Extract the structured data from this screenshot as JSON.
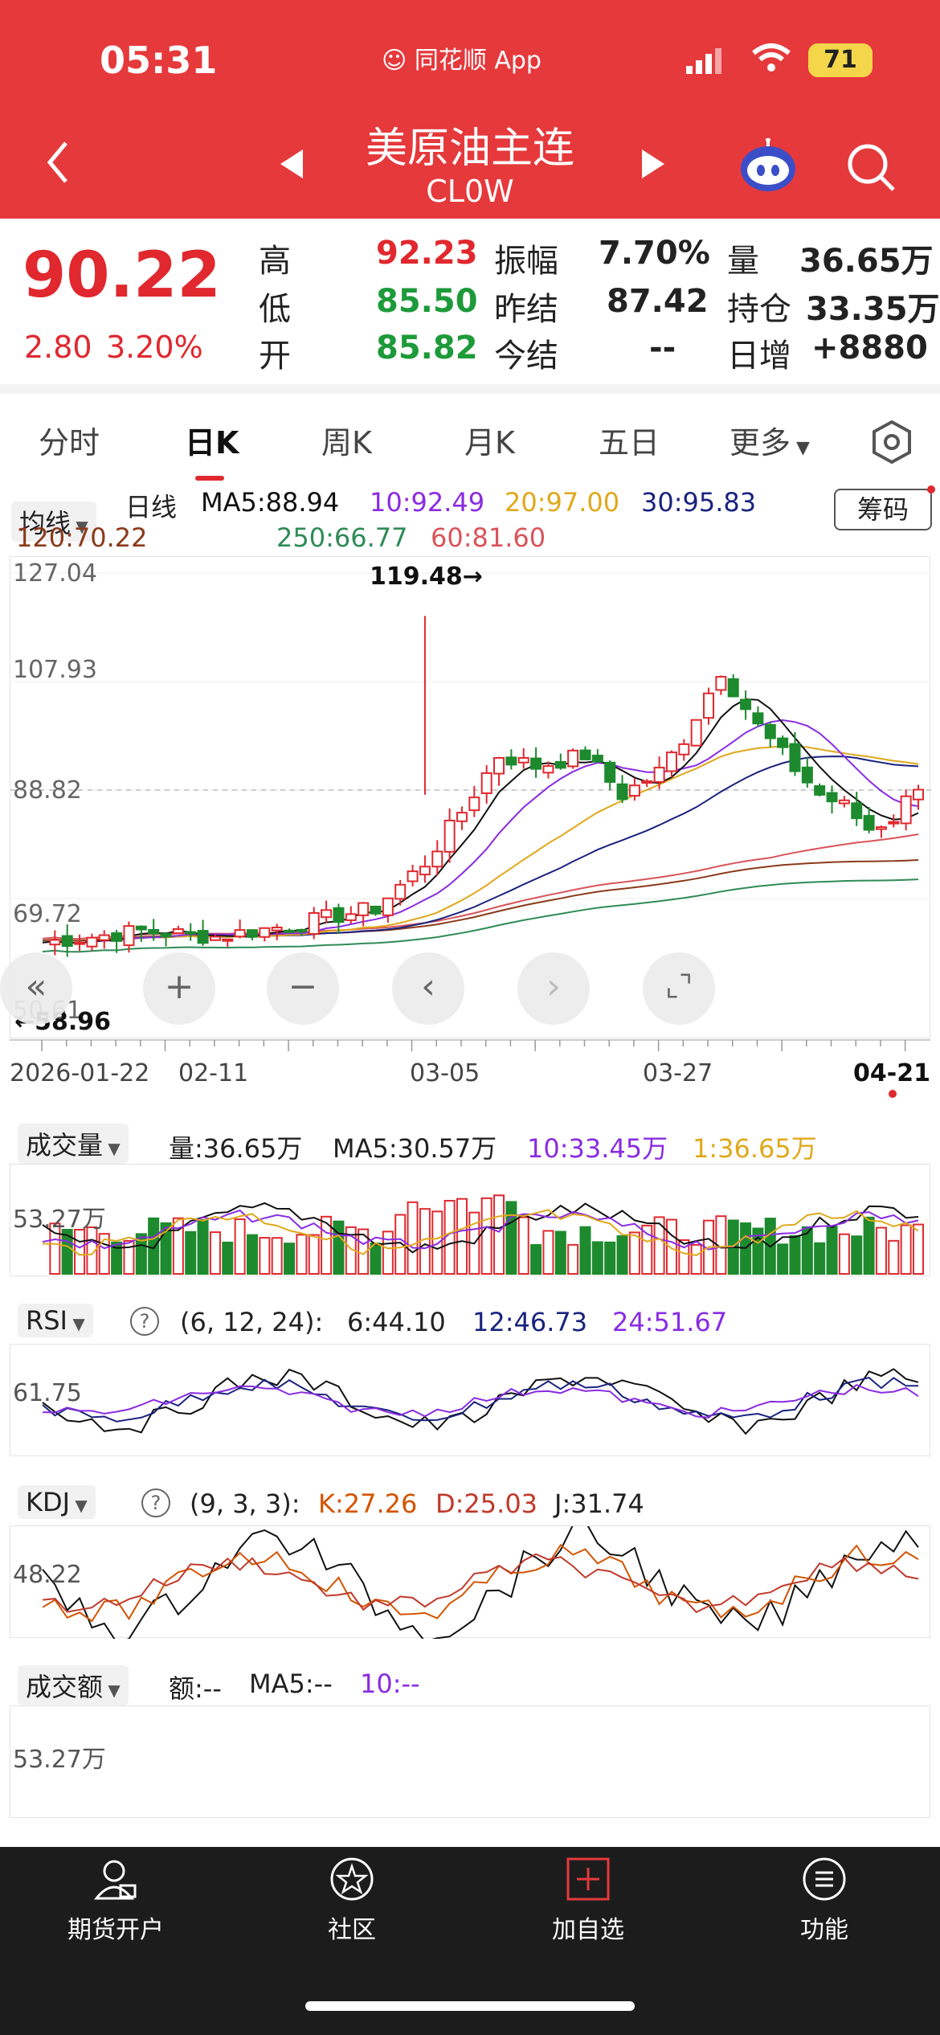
{
  "status": {
    "time": "05:31",
    "app": "同花顺 App",
    "battery": "71"
  },
  "header": {
    "title": "美原油主连",
    "code": "CL0W"
  },
  "quote": {
    "price": "90.22",
    "change": "2.80",
    "pct": "3.20%",
    "high_label": "高",
    "high": "92.23",
    "low_label": "低",
    "low": "85.50",
    "open_label": "开",
    "open": "85.82",
    "amp_label": "振幅",
    "amp": "7.70%",
    "prev_label": "昨结",
    "prev": "87.42",
    "today_label": "今结",
    "today": "--",
    "vol_label": "量",
    "vol": "36.65万",
    "oi_label": "持仓",
    "oi": "33.35万",
    "dinc_label": "日增",
    "dinc": "+8880"
  },
  "tabs": [
    "分时",
    "日K",
    "周K",
    "月K",
    "五日",
    "更多"
  ],
  "ma_bar": {
    "selector": "均线",
    "line": "日线",
    "ma5": "MA5:88.94",
    "ma10": "10:92.49",
    "ma20": "20:97.00",
    "ma30": "30:95.83",
    "ma120": "120:70.22",
    "ma250": "250:66.77",
    "ma60": "60:81.60",
    "chip_button": "筹码"
  },
  "colors": {
    "up": "#e0282e",
    "down": "#1d8a2e",
    "ma5": "#111111",
    "ma10": "#8a2be2",
    "ma20": "#e0a81c",
    "ma30": "#1a237e",
    "ma120": "#8b3a1a",
    "ma250": "#2e8b57",
    "ma60": "#d9545a",
    "header": "#e5393c"
  },
  "kline": {
    "axis_labels": [
      "127.04",
      "107.93",
      "88.82",
      "69.72",
      "50.61"
    ],
    "high_marker": "119.48→",
    "low_marker": "←58.96",
    "dates": [
      "2026-01-22",
      "02-11",
      "03-05",
      "03-27",
      "04-21"
    ]
  },
  "volume": {
    "selector": "成交量",
    "vol": "量:36.65万",
    "ma5": "MA5:30.57万",
    "ma10": "10:33.45万",
    "ma1": "1:36.65万",
    "axis": "53.27万"
  },
  "rsi": {
    "selector": "RSI",
    "params": "(6, 12, 24):",
    "r6": "6:44.10",
    "r12": "12:46.73",
    "r24": "24:51.67",
    "axis": "61.75"
  },
  "kdj": {
    "selector": "KDJ",
    "params": "(9, 3, 3):",
    "k": "K:27.26",
    "d": "D:25.03",
    "j": "J:31.74",
    "axis": "48.22"
  },
  "turnover": {
    "selector": "成交额",
    "amt": "额:--",
    "ma5": "MA5:--",
    "ma10": "10:--",
    "axis": "53.27万"
  },
  "nav": [
    {
      "label": "期货开户"
    },
    {
      "label": "社区"
    },
    {
      "label": "加自选"
    },
    {
      "label": "功能"
    }
  ],
  "chart_data": {
    "type": "candlestick",
    "ylim": [
      50.61,
      127.04
    ],
    "y_ticks": [
      127.04,
      107.93,
      88.82,
      69.72,
      50.61
    ],
    "x_tick_labels": [
      "2026-01-22",
      "02-11",
      "03-05",
      "03-27",
      "04-21"
    ],
    "high_marker": 119.48,
    "low_marker": 58.96,
    "series": [
      {
        "name": "MA5",
        "value": 88.94
      },
      {
        "name": "10",
        "value": 92.49
      },
      {
        "name": "20",
        "value": 97.0
      },
      {
        "name": "30",
        "value": 95.83
      },
      {
        "name": "120",
        "value": 70.22
      },
      {
        "name": "250",
        "value": 66.77
      },
      {
        "name": "60",
        "value": 81.6
      }
    ],
    "volume": {
      "latest": "36.65万",
      "axis_label": "53.27万"
    },
    "rsi": {
      "r6": 44.1,
      "r12": 46.73,
      "r24": 51.67
    },
    "kdj": {
      "k": 27.26,
      "d": 25.03,
      "j": 31.74
    }
  }
}
